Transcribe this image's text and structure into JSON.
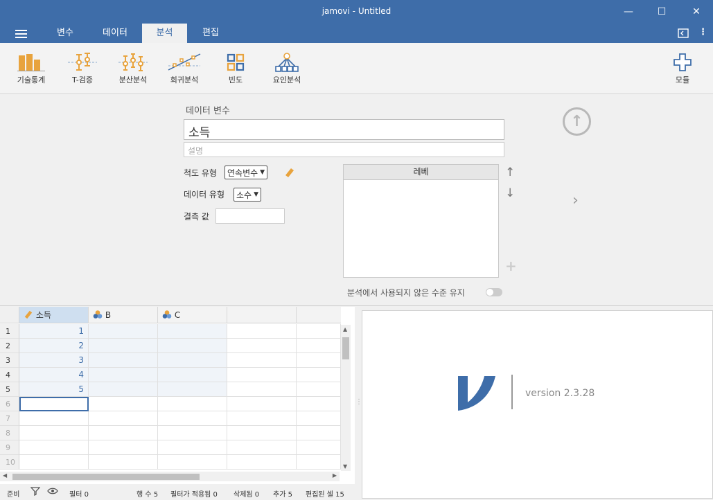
{
  "window": {
    "title": "jamovi - Untitled"
  },
  "menu": {
    "tabs": [
      {
        "label": "변수"
      },
      {
        "label": "데이터"
      },
      {
        "label": "분석"
      },
      {
        "label": "편집"
      }
    ]
  },
  "ribbon": {
    "buttons": [
      {
        "label": "기술통계"
      },
      {
        "label": "T-검증"
      },
      {
        "label": "분산분석"
      },
      {
        "label": "회귀분석"
      },
      {
        "label": "빈도"
      },
      {
        "label": "요인분석"
      }
    ],
    "modules_label": "모듈"
  },
  "editor": {
    "data_variable_label": "데이터 변수",
    "variable_name": "소득",
    "description_placeholder": "설명",
    "measure_type_label": "척도 유형",
    "measure_type_value": "연속변수",
    "data_type_label": "데이터 유형",
    "data_type_value": "소수",
    "missing_values_label": "결측 값",
    "levels_header": "레베",
    "retain_unused_label": "분석에서 사용되지 않은 수준 유지"
  },
  "sheet": {
    "columns": [
      {
        "name": "소득",
        "icon": "ruler-icon"
      },
      {
        "name": "B",
        "icon": "nominal-circles-icon"
      },
      {
        "name": "C",
        "icon": "nominal-circles-icon"
      }
    ],
    "row_numbers": [
      "1",
      "2",
      "3",
      "4",
      "5",
      "6",
      "7",
      "8",
      "9",
      "10"
    ],
    "values": [
      "1",
      "2",
      "3",
      "4",
      "5"
    ]
  },
  "results": {
    "version": "version 2.3.28"
  },
  "status": {
    "ready": "준비",
    "filter": "필터 0",
    "rows": "행 수 5",
    "filtered": "필터가 적용됨 0",
    "deleted": "삭제됨 0",
    "added": "추가 5",
    "edited": "편집된 셀 15"
  },
  "colors": {
    "accent": "#3e6da9",
    "ribbon_icon": "#e8a33d"
  }
}
